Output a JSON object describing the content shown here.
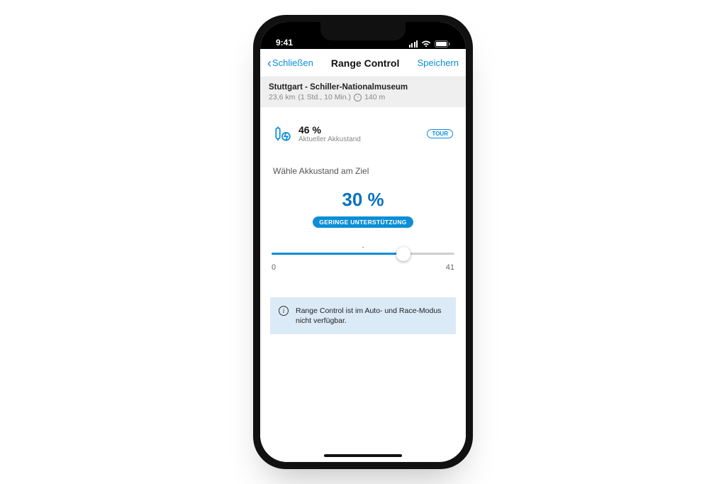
{
  "status": {
    "time": "9:41"
  },
  "nav": {
    "back": "Schließen",
    "title": "Range Control",
    "save": "Speichern"
  },
  "route": {
    "title": "Stuttgart - Schiller-Nationalmuseum",
    "distance": "23,6 km",
    "duration": "(1 Std., 10 Min.)",
    "elevation": "140 m"
  },
  "battery": {
    "percent": "46 %",
    "label": "Aktueller Akkustand",
    "mode": "TOUR"
  },
  "target": {
    "section_label": "Wähle Akkustand am Ziel",
    "percent": "30 %",
    "assist_label": "GERINGE UNTERSTÜTZUNG"
  },
  "slider": {
    "min": "0",
    "max": "41",
    "value": 30,
    "range_max": 41
  },
  "info": {
    "text": "Range Control ist im Auto- und Race-Modus nicht verfügbar."
  }
}
